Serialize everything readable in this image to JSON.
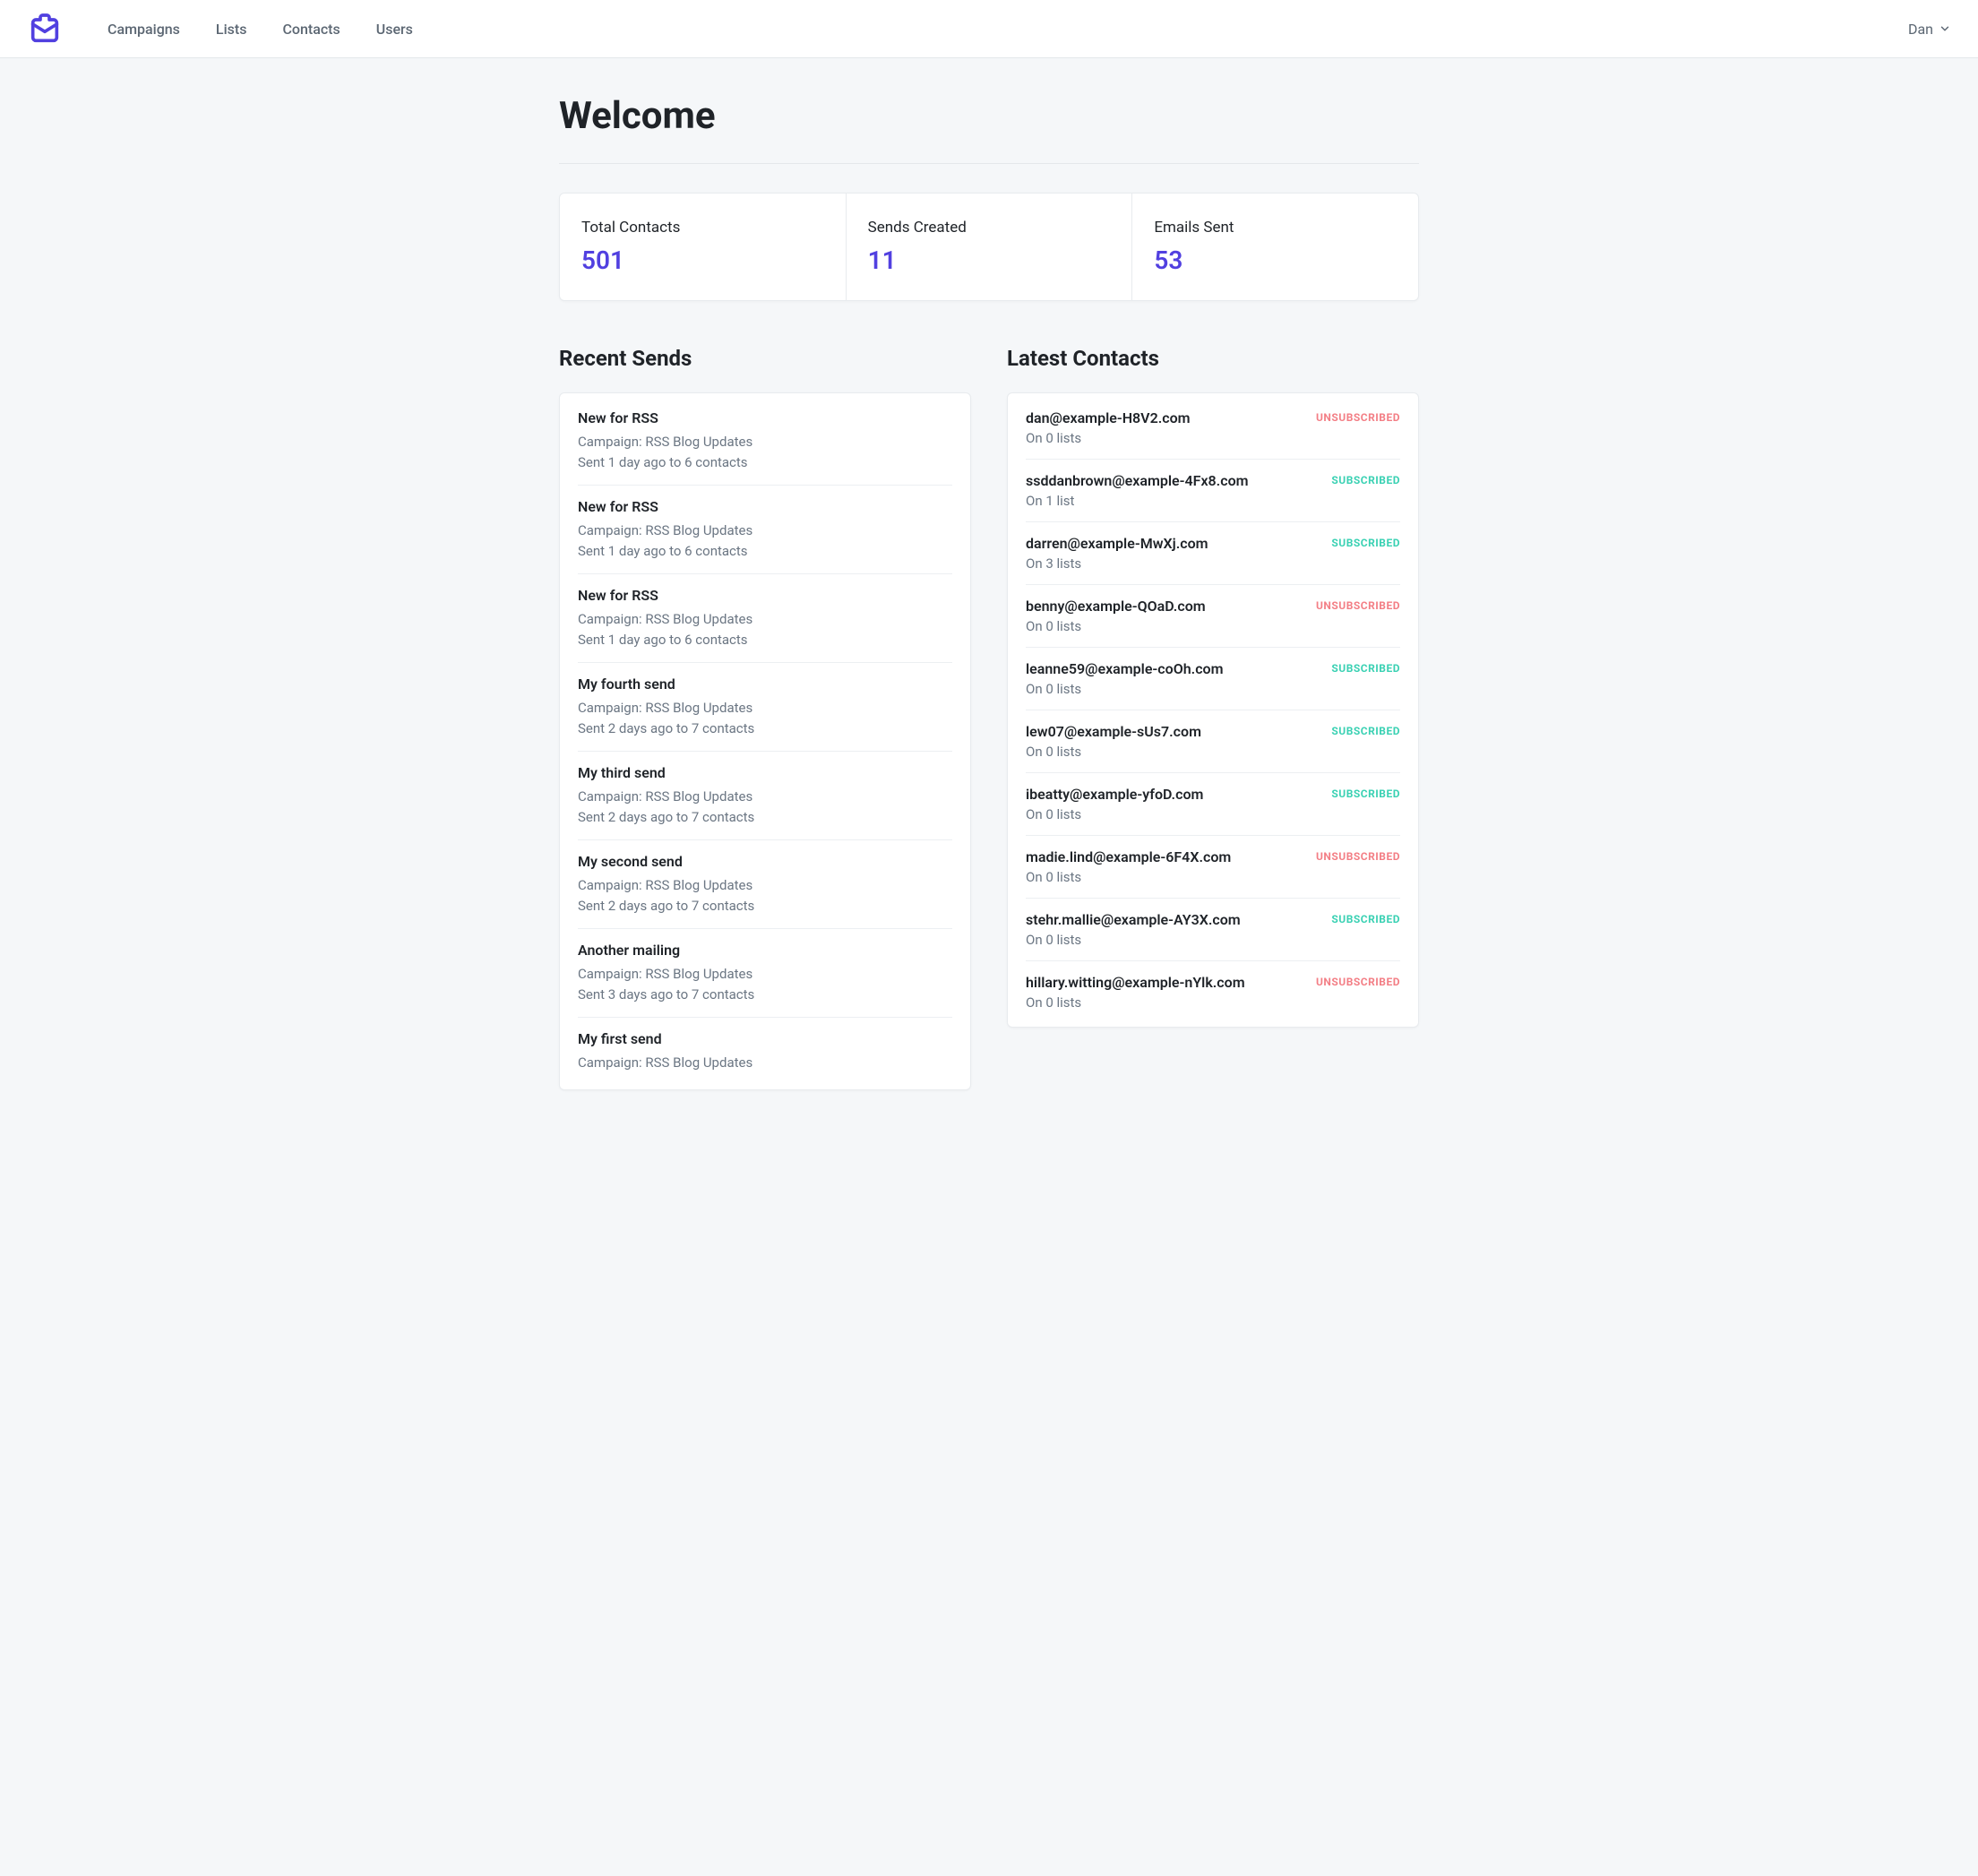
{
  "nav": {
    "items": [
      "Campaigns",
      "Lists",
      "Contacts",
      "Users"
    ],
    "user": "Dan"
  },
  "page_title": "Welcome",
  "stats": [
    {
      "label": "Total Contacts",
      "value": "501"
    },
    {
      "label": "Sends Created",
      "value": "11"
    },
    {
      "label": "Emails Sent",
      "value": "53"
    }
  ],
  "recent_sends": {
    "title": "Recent Sends",
    "items": [
      {
        "name": "New for RSS",
        "campaign": "Campaign: RSS Blog Updates",
        "meta": "Sent 1 day ago to 6 contacts"
      },
      {
        "name": "New for RSS",
        "campaign": "Campaign: RSS Blog Updates",
        "meta": "Sent 1 day ago to 6 contacts"
      },
      {
        "name": "New for RSS",
        "campaign": "Campaign: RSS Blog Updates",
        "meta": "Sent 1 day ago to 6 contacts"
      },
      {
        "name": "My fourth send",
        "campaign": "Campaign: RSS Blog Updates",
        "meta": "Sent 2 days ago to 7 contacts"
      },
      {
        "name": "My third send",
        "campaign": "Campaign: RSS Blog Updates",
        "meta": "Sent 2 days ago to 7 contacts"
      },
      {
        "name": "My second send",
        "campaign": "Campaign: RSS Blog Updates",
        "meta": "Sent 2 days ago to 7 contacts"
      },
      {
        "name": "Another mailing",
        "campaign": "Campaign: RSS Blog Updates",
        "meta": "Sent 3 days ago to 7 contacts"
      },
      {
        "name": "My first send",
        "campaign": "Campaign: RSS Blog Updates",
        "meta": ""
      }
    ]
  },
  "latest_contacts": {
    "title": "Latest Contacts",
    "sub_label": "SUBSCRIBED",
    "unsub_label": "UNSUBSCRIBED",
    "items": [
      {
        "email": "dan@example-H8V2.com",
        "lists": "On 0 lists",
        "status": "unsub"
      },
      {
        "email": "ssddanbrown@example-4Fx8.com",
        "lists": "On 1 list",
        "status": "sub"
      },
      {
        "email": "darren@example-MwXj.com",
        "lists": "On 3 lists",
        "status": "sub"
      },
      {
        "email": "benny@example-QOaD.com",
        "lists": "On 0 lists",
        "status": "unsub"
      },
      {
        "email": "leanne59@example-coOh.com",
        "lists": "On 0 lists",
        "status": "sub"
      },
      {
        "email": "lew07@example-sUs7.com",
        "lists": "On 0 lists",
        "status": "sub"
      },
      {
        "email": "ibeatty@example-yfoD.com",
        "lists": "On 0 lists",
        "status": "sub"
      },
      {
        "email": "madie.lind@example-6F4X.com",
        "lists": "On 0 lists",
        "status": "unsub"
      },
      {
        "email": "stehr.mallie@example-AY3X.com",
        "lists": "On 0 lists",
        "status": "sub"
      },
      {
        "email": "hillary.witting@example-nYlk.com",
        "lists": "On 0 lists",
        "status": "unsub"
      }
    ]
  }
}
